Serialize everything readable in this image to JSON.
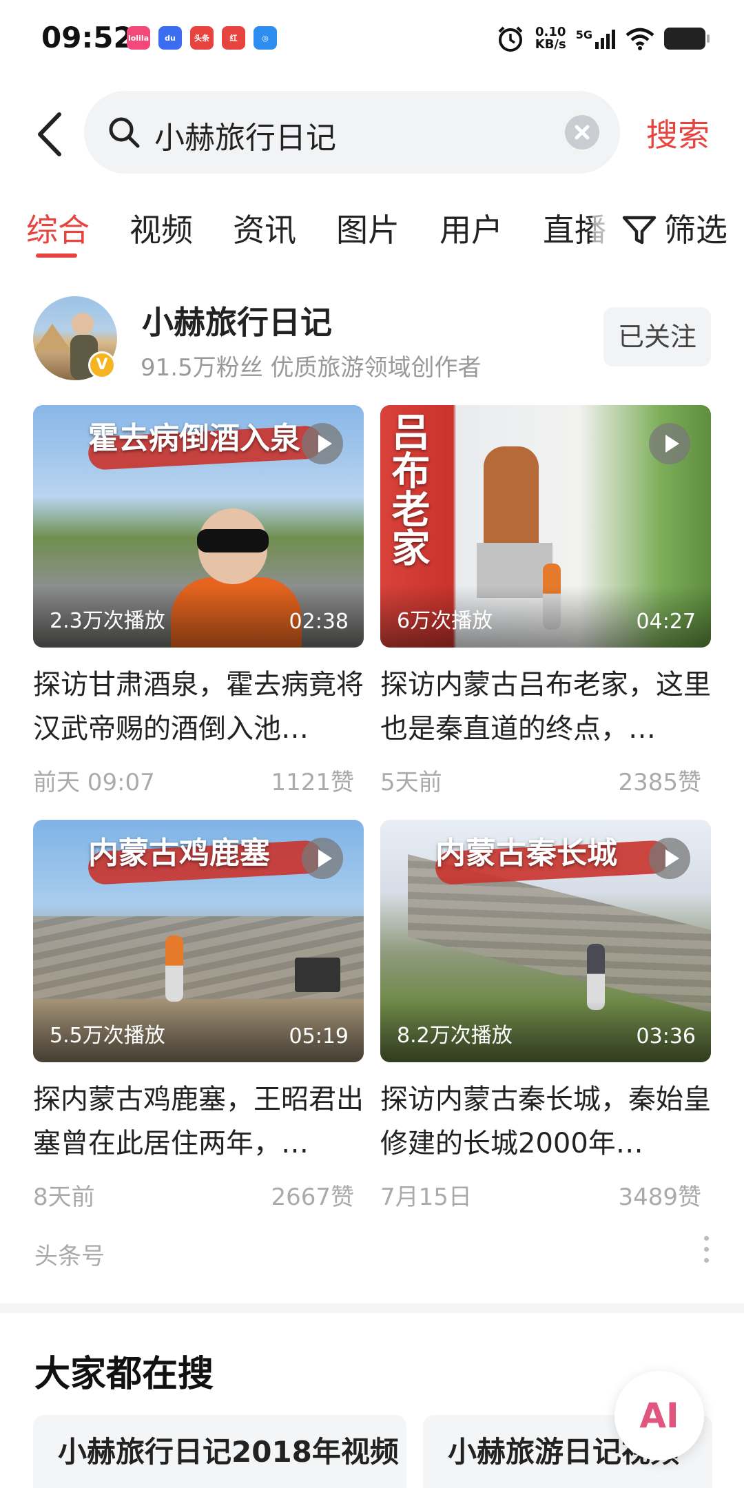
{
  "status_bar": {
    "time": "09:52",
    "apps": [
      {
        "name": "lolila",
        "label": "lolila",
        "color": "#f0497a"
      },
      {
        "name": "baidu",
        "label": "du",
        "color": "#3a6df0"
      },
      {
        "name": "toutiao",
        "label": "头条",
        "color": "#e8443f"
      },
      {
        "name": "gift-app",
        "label": "红",
        "color": "#e8443f"
      },
      {
        "name": "browser-app",
        "label": "◎",
        "color": "#2e8ef0"
      }
    ],
    "speed_value": "0.10",
    "speed_unit": "KB/s",
    "network": "5G"
  },
  "search": {
    "query": "小赫旅行日记",
    "submit_label": "搜索"
  },
  "tabs": {
    "items": [
      "综合",
      "视频",
      "资讯",
      "图片",
      "用户",
      "直播"
    ],
    "active_index": 0,
    "filter_label": "筛选"
  },
  "author": {
    "name": "小赫旅行日记",
    "meta": "91.5万粉丝 优质旅游领域创作者",
    "badge": "V",
    "follow_label": "已关注"
  },
  "videos": [
    {
      "thumb_title": "霍去病倒酒入泉",
      "plays": "2.3万次播放",
      "duration": "02:38",
      "title": "探访甘肃酒泉，霍去病竟将汉武帝赐的酒倒入池…",
      "date": "前天 09:07",
      "likes": "1121赞"
    },
    {
      "thumb_title": "吕布老家",
      "plays": "6万次播放",
      "duration": "04:27",
      "title": "探访内蒙古吕布老家，这里也是秦直道的终点，…",
      "date": "5天前",
      "likes": "2385赞"
    },
    {
      "thumb_title": "内蒙古鸡鹿塞",
      "plays": "5.5万次播放",
      "duration": "05:19",
      "title": "探内蒙古鸡鹿塞，王昭君出塞曾在此居住两年，…",
      "date": "8天前",
      "likes": "2667赞"
    },
    {
      "thumb_title": "内蒙古秦长城",
      "plays": "8.2万次播放",
      "duration": "03:36",
      "title": "探访内蒙古秦长城，秦始皇修建的长城2000年…",
      "date": "7月15日",
      "likes": "3489赞"
    }
  ],
  "source_label": "头条号",
  "trending": {
    "title": "大家都在搜",
    "chips": [
      "小赫旅行日记2018年视频",
      "小赫旅游日记视频"
    ]
  },
  "ai_button_label": "AI",
  "colors": {
    "accent": "#e8443f",
    "muted_text": "#999999",
    "chip_background": "#f4f5f7"
  }
}
